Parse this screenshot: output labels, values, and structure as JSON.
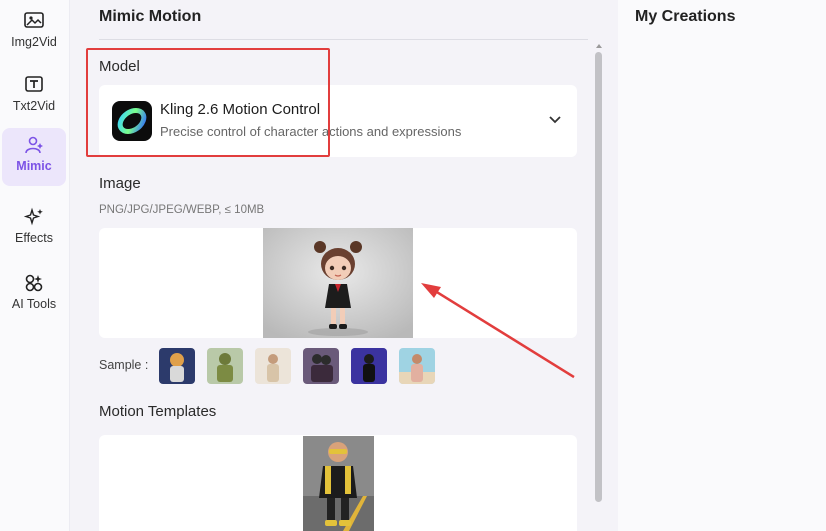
{
  "nav": {
    "items": [
      {
        "label": "Img2Vid",
        "icon": "image-video-icon",
        "active": false
      },
      {
        "label": "Txt2Vid",
        "icon": "text-video-icon",
        "active": false
      },
      {
        "label": "Mimic",
        "icon": "person-sparkle-icon",
        "active": true
      },
      {
        "label": "Effects",
        "icon": "sparkles-icon",
        "active": false
      },
      {
        "label": "AI Tools",
        "icon": "apps-icon",
        "active": false
      }
    ]
  },
  "main": {
    "title": "Mimic Motion",
    "model_section": {
      "label": "Model",
      "selected_name": "Kling 2.6 Motion Control",
      "selected_desc": "Precise control of character actions and expressions"
    },
    "image_section": {
      "label": "Image",
      "hint": "PNG/JPG/JPEG/WEBP, ≤ 10MB"
    },
    "sample_label": "Sample :",
    "motion_section": {
      "label": "Motion Templates"
    }
  },
  "right": {
    "title": "My Creations"
  },
  "colors": {
    "accent": "#7c53e6",
    "highlight_red": "#e23d3d",
    "active_nav_bg": "#ece6fb"
  }
}
